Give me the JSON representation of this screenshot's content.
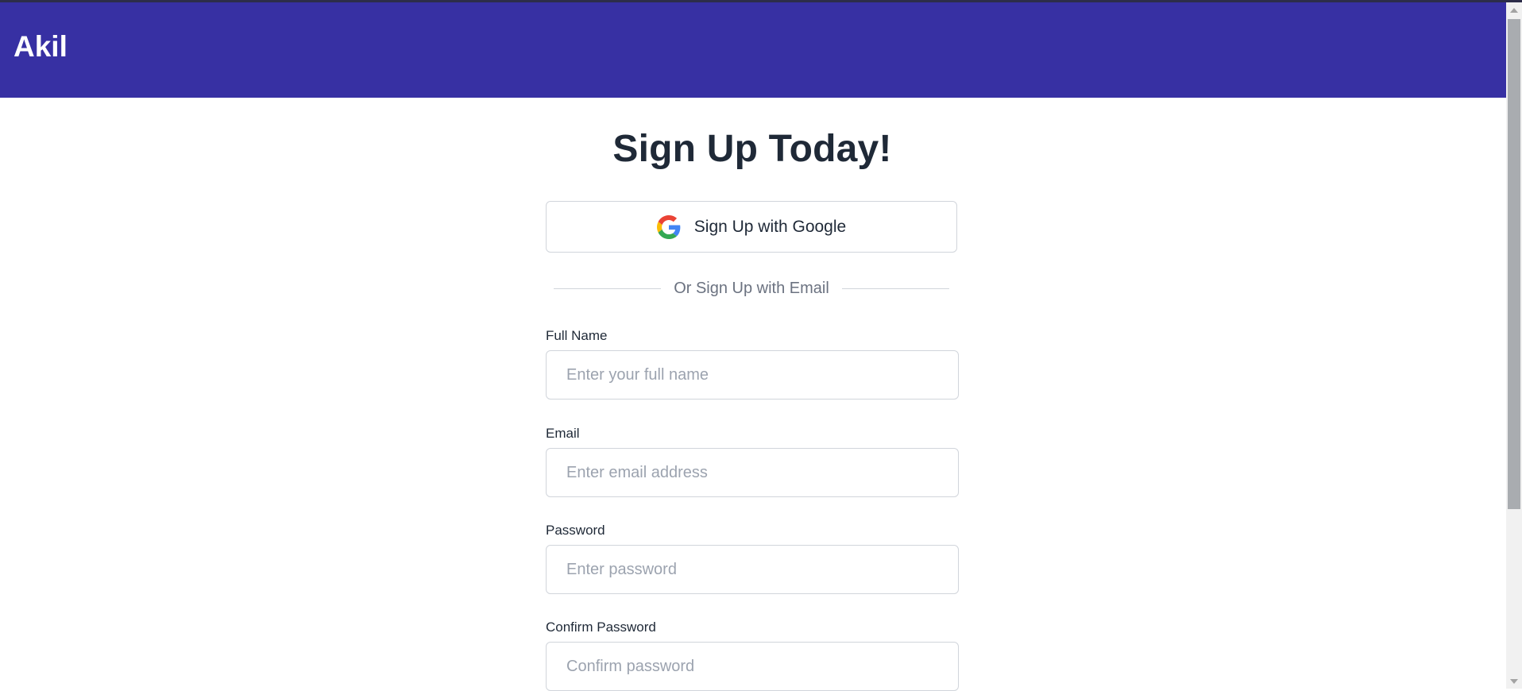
{
  "header": {
    "brand": "Akil",
    "background_color": "#3730a3"
  },
  "main": {
    "title": "Sign Up Today!",
    "google_button": {
      "label": "Sign Up with Google",
      "icon": "google-icon"
    },
    "divider_text": "Or Sign Up with Email",
    "fields": [
      {
        "label": "Full Name",
        "placeholder": "Enter your full name",
        "value": ""
      },
      {
        "label": "Email",
        "placeholder": "Enter email address",
        "value": ""
      },
      {
        "label": "Password",
        "placeholder": "Enter password",
        "value": ""
      },
      {
        "label": "Confirm Password",
        "placeholder": "Confirm password",
        "value": ""
      }
    ]
  }
}
